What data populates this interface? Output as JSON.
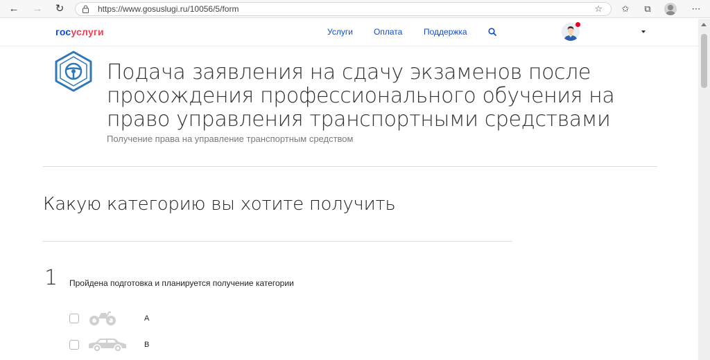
{
  "browser": {
    "url": "https://www.gosuslugi.ru/10056/5/form",
    "back_glyph": "←",
    "forward_glyph": "→",
    "reload_glyph": "↻",
    "star_glyph": "☆",
    "reading_list_glyph": "✩",
    "collections_glyph": "⧉",
    "menu_glyph": "⋯"
  },
  "header": {
    "logo_gos": "гос",
    "logo_uslugi": "услуги",
    "nav": [
      {
        "label": "Услуги"
      },
      {
        "label": "Оплата"
      },
      {
        "label": "Поддержка"
      }
    ]
  },
  "service": {
    "title": "Подача заявления на сдачу экзаменов после прохождения профессионального обучения на право управления транспортными средствами",
    "subtitle": "Получение права на управление транспортным средством",
    "icon_color": "#2e77b8"
  },
  "question": {
    "title": "Какую категорию вы хотите получить"
  },
  "step": {
    "number": "1",
    "label": "Пройдена подготовка и планируется получение категории",
    "options": [
      {
        "label": "A",
        "icon": "motorcycle-icon",
        "checked": false
      },
      {
        "label": "B",
        "icon": "car-icon",
        "checked": false
      }
    ]
  }
}
